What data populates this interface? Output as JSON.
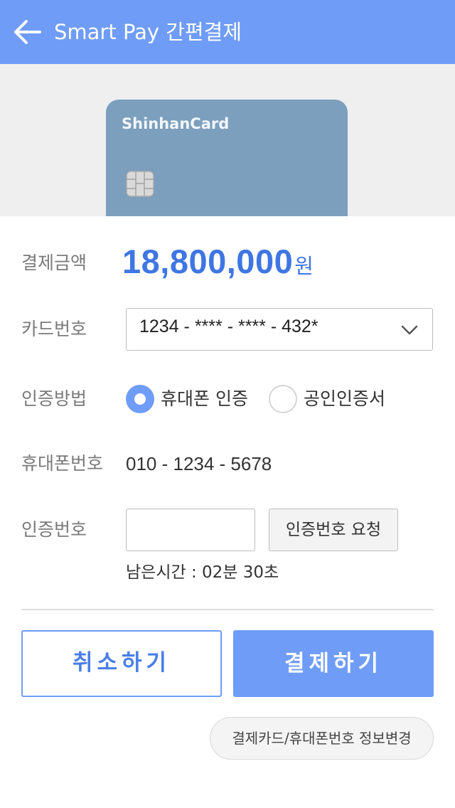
{
  "header": {
    "title": "Smart Pay 간편결제",
    "back_icon": "arrow-left-icon",
    "color": "#6f9cf7"
  },
  "card": {
    "brand": "ShinhanCard",
    "color": "#7b9fbd",
    "chip_icon": "card-chip-icon"
  },
  "form": {
    "amount": {
      "label": "결제금액",
      "value": "18,800,000",
      "unit": "원",
      "color": "#3f76e4"
    },
    "card_number": {
      "label": "카드번호",
      "value": "1234 - **** - **** - 432*",
      "dropdown_icon": "chevron-down-icon"
    },
    "auth_method": {
      "label": "인증방법",
      "options": [
        {
          "label": "휴대폰 인증",
          "selected": true
        },
        {
          "label": "공인인증서",
          "selected": false
        }
      ]
    },
    "phone": {
      "label": "휴대폰번호",
      "value": "010 - 1234 - 5678"
    },
    "auth_code": {
      "label": "인증번호",
      "value": "",
      "request_button": "인증번호 요청",
      "timer": "남은시간 : 02분 30초"
    }
  },
  "actions": {
    "cancel": "취소하기",
    "pay": "결제하기",
    "change_info": "결제카드/휴대폰번호 정보변경"
  }
}
